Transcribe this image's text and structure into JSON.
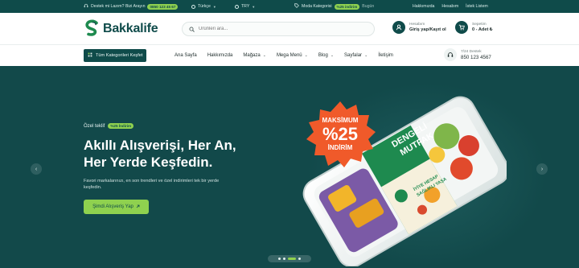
{
  "topbar": {
    "support_text": "Destek mi Lazım? Bizi Arayın",
    "support_phone": "0850 123 45 67",
    "language": "Türkçe",
    "currency": "TRY",
    "promo_text": "Moda Kategorisi",
    "promo_badge": "%25 indirim",
    "promo_suffix": "Bugün",
    "links": [
      "Hakkımızda",
      "Hesabım",
      "İstek Listem"
    ]
  },
  "header": {
    "logo": "Bakkalife",
    "search_placeholder": "Ürünleri ara...",
    "account_label": "Hesabım",
    "account_action": "Giriş yap/Kayıt ol",
    "cart_label": "Sepetim",
    "cart_summary": "0 - Adet ₺"
  },
  "nav": {
    "categories_button": "Tüm Kategorileri Keşfet",
    "items": [
      {
        "label": "Ana Sayfa",
        "dropdown": false
      },
      {
        "label": "Hakkımızda",
        "dropdown": false
      },
      {
        "label": "Mağaza",
        "dropdown": true
      },
      {
        "label": "Mega Menü",
        "dropdown": true
      },
      {
        "label": "Blog",
        "dropdown": true
      },
      {
        "label": "Sayfalar",
        "dropdown": true
      },
      {
        "label": "İletişim",
        "dropdown": false
      }
    ],
    "support_label": "7/24 Destek",
    "support_phone": "850 123 4567"
  },
  "hero": {
    "offer_label": "Özel teklif",
    "offer_badge": "%25 İndirim",
    "title_line1": "Akıllı Alışverişi, Her An,",
    "title_line2": "Her Yerde Keşfedin.",
    "subtitle": "Favori markalarınızı, en son trendleri ve özel indirimleri tek bir yerde keşfedin.",
    "cta": "Şimdi Alışveriş Yap",
    "badge_top": "MAKSİMUM",
    "badge_value": "%25",
    "badge_bottom": "İNDİRİM",
    "product_label_1": "DENGELİ",
    "product_label_2": "MUTFAK",
    "product_small": "İYİYE HESAP",
    "product_small2": "SAĞLIKLI YAŞA"
  },
  "slider": {
    "slide_count": 4,
    "active_slide": 3
  },
  "colors": {
    "primary": "#0f4b4a",
    "accent": "#8fd14f",
    "badge": "#f05a2a"
  }
}
